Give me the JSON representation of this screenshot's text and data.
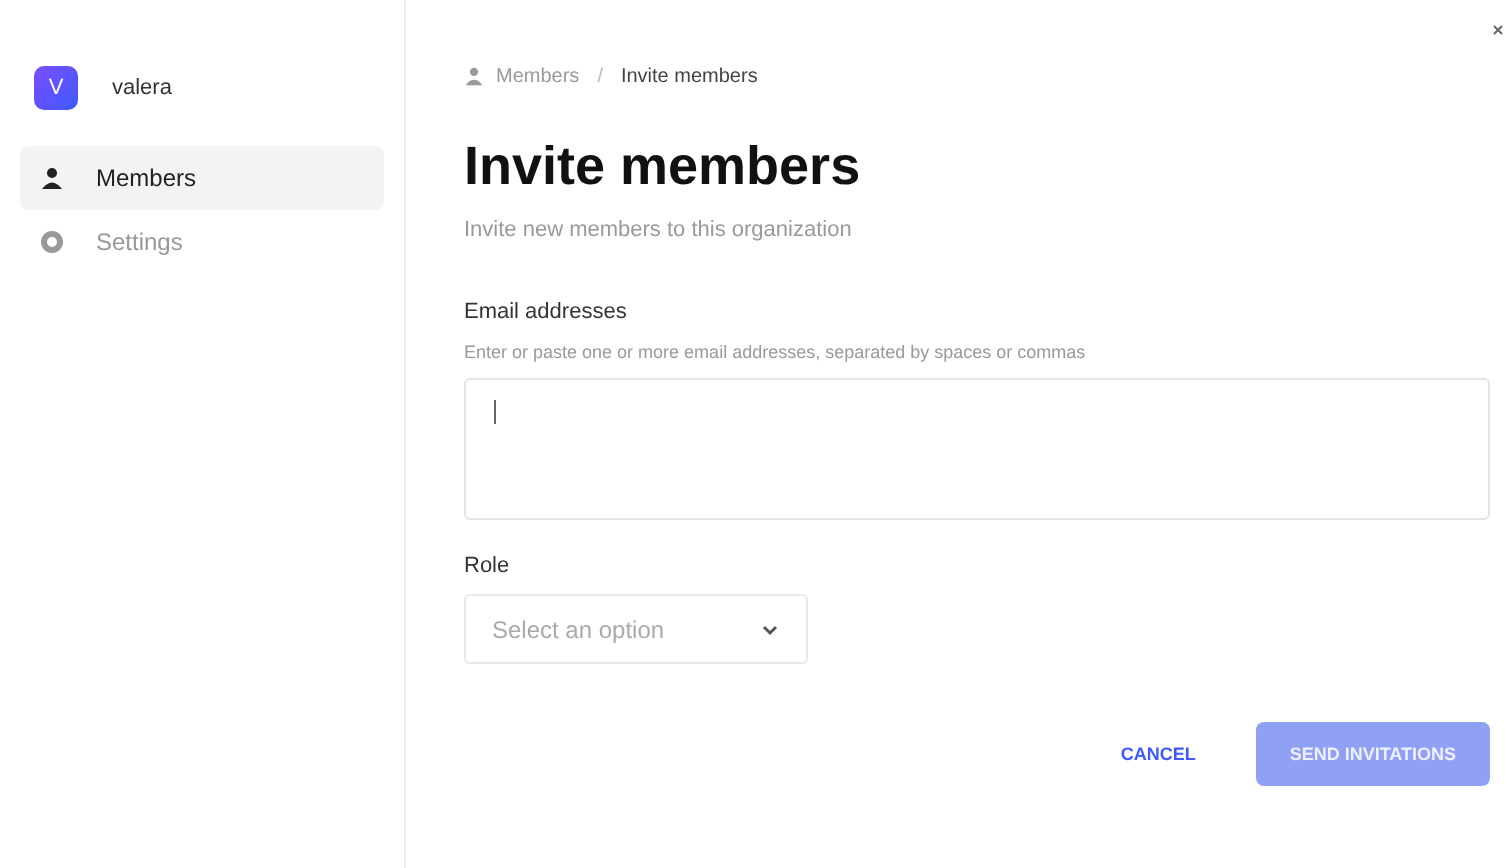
{
  "sidebar": {
    "org": {
      "initial": "V",
      "name": "valera"
    },
    "items": [
      {
        "label": "Members",
        "kind": "person",
        "selected": true
      },
      {
        "label": "Settings",
        "kind": "gear",
        "selected": false
      }
    ]
  },
  "breadcrumb": [
    {
      "label": "Members",
      "kind": "person"
    },
    {
      "label": "Invite members",
      "kind": "text"
    }
  ],
  "breadcrumb_separator": "/",
  "title": "Invite members",
  "subtitle": "Invite new members to this organization",
  "email": {
    "label": "Email addresses",
    "hint": "Enter or paste one or more email addresses, separated by spaces or commas",
    "focused": true
  },
  "role": {
    "label": "Role",
    "placeholder": "Select an option"
  },
  "buttons": [
    {
      "label": "CANCEL",
      "kind": "text",
      "disabled": false
    },
    {
      "label": "SEND INVITATIONS",
      "kind": "primary",
      "disabled": true
    }
  ]
}
